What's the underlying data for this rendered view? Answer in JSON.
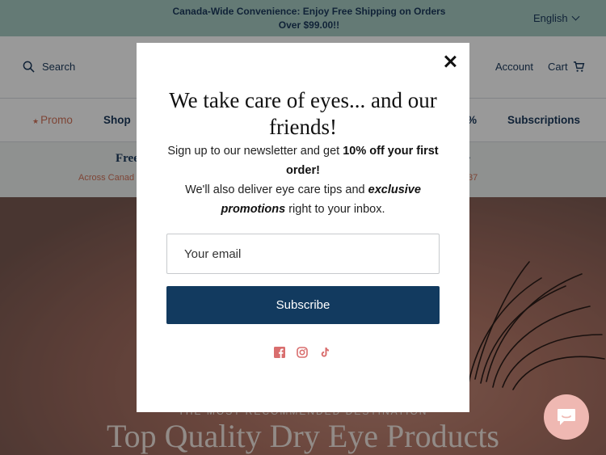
{
  "announcement": {
    "text": "Canada-Wide Convenience: Enjoy Free Shipping on Orders Over $99.00!!",
    "language": "English"
  },
  "header": {
    "search_label": "Search",
    "account_label": "Account",
    "cart_label": "Cart"
  },
  "nav": {
    "items": [
      {
        "label": "Promo"
      },
      {
        "label": "Shop"
      },
      {
        "label": "%"
      },
      {
        "label": "Subscriptions"
      }
    ]
  },
  "benefits": {
    "title_left": "Free",
    "sub_left": "Across Canad",
    "title_right": "·",
    "sub_right": "37"
  },
  "hero": {
    "eyebrow": "THE MOST RECOMMENDED DESTINATION",
    "title": "Top Quality Dry Eye Products"
  },
  "modal": {
    "title": "We take care of eyes... and our friends!",
    "line1_a": "Sign up to our newsletter and get ",
    "line1_b": "10% off your first order!",
    "line2_a": "We'll also deliver eye care tips and ",
    "line2_b": "exclusive promotions",
    "line2_c": " right to your inbox.",
    "email_placeholder": "Your email",
    "subscribe_label": "Subscribe",
    "social_icons": [
      "facebook-icon",
      "instagram-icon",
      "tiktok-icon"
    ]
  },
  "colors": {
    "announcement_bg": "#a7ccc4",
    "navy": "#1b3a5c",
    "button": "#123a5f",
    "accent": "#d3735a",
    "social": "#d96e6e",
    "chat_bubble": "#efb8b2"
  }
}
